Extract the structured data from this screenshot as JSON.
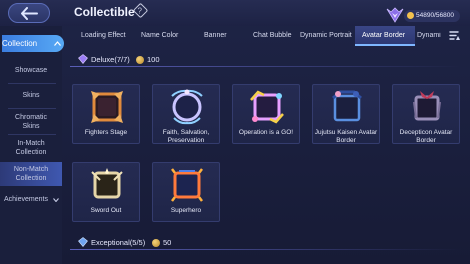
{
  "header": {
    "title": "Collectible",
    "help_glyph": "?",
    "currency": "54890/56800"
  },
  "sidebar": {
    "items": [
      {
        "label": "Collection",
        "state": "expanded"
      },
      {
        "label": "Showcase"
      },
      {
        "label": "Skins"
      },
      {
        "label": "Chromatic Skins"
      },
      {
        "label": "In-Match Collection"
      },
      {
        "label": "Non-Match Collection",
        "state": "selected"
      },
      {
        "label": "Achievements"
      }
    ]
  },
  "tabs": [
    {
      "label": "Loading Effect"
    },
    {
      "label": "Name Color"
    },
    {
      "label": "Banner"
    },
    {
      "label": "Chat Bubble"
    },
    {
      "label": "Dynamic Portrait"
    },
    {
      "label": "Avatar Border",
      "active": true
    },
    {
      "label": "Dynami"
    }
  ],
  "sections": [
    {
      "title": "Deluxe(7/7)",
      "points": "100",
      "items": [
        {
          "name": "Fighters Stage"
        },
        {
          "name": "Faith, Salvation, Preservation"
        },
        {
          "name": "Operation is a GO!"
        },
        {
          "name": "Jujutsu Kaisen Avatar Border"
        },
        {
          "name": "Decepticon Avatar Border"
        },
        {
          "name": "Sword Out"
        },
        {
          "name": "Superhero"
        }
      ]
    },
    {
      "title": "Exceptional(5/5)",
      "points": "50",
      "items": []
    }
  ],
  "icons": {
    "back": "back-arrow-icon",
    "help": "help-icon",
    "currency": "emblem-icon",
    "filter": "filter-icon",
    "section": "gem-icon",
    "points": "coin-icon"
  },
  "colors": {
    "accent": "#4f9cf0",
    "background": "#1b2042",
    "gold": "#f2c14e"
  }
}
